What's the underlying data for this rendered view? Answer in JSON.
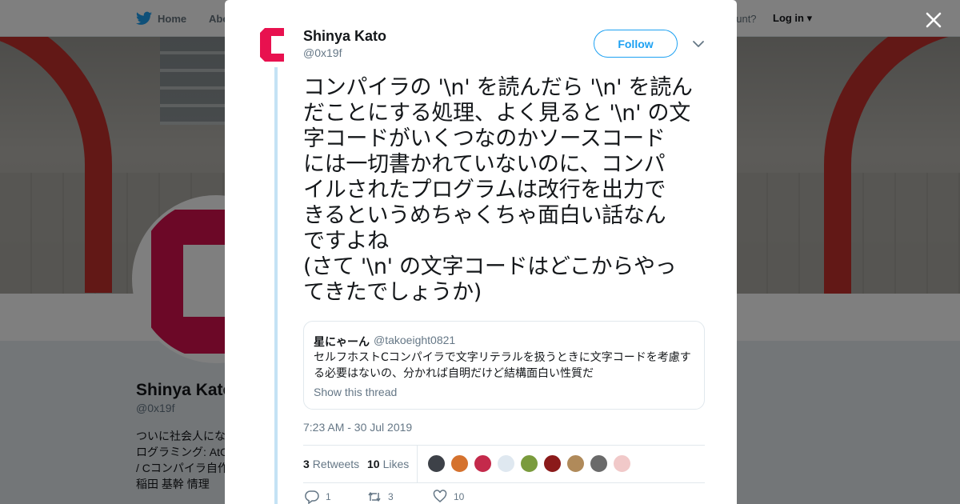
{
  "nav": {
    "home_label": "Home",
    "about_label": "Abo",
    "account_text": "ccount?",
    "login_label": "Log in"
  },
  "background_profile": {
    "name": "Shinya Kato",
    "handle": "@0x19f",
    "bio_lines": [
      "ついに社会人にな",
      "ログラミング: AtC",
      "/ Cコンパイラ自作",
      "稲田 基幹 情理"
    ]
  },
  "tweet": {
    "author_name": "Shinya Kato",
    "author_handle": "@0x19f",
    "follow_label": "Follow",
    "text": "コンパイラの '\\n' を読んだら '\\n' を読ん\nだことにする処理、よく見ると '\\n' の文\n字コードがいくつなのかソースコード\nには一切書かれていないのに、コンパ\nイルされたプログラムは改行を出力で\nきるというめちゃくちゃ面白い話なん\nですよね\n(さて '\\n' の文字コードはどこからやっ\nてきたでしょうか)",
    "quoted": {
      "name": "星にゃーん",
      "handle": "@takoeight0821",
      "text": "セルフホストCコンパイラで文字リテラルを扱うときに文字コードを考慮する必要はないの、分かれば自明だけど結構面白い性質だ",
      "show_thread": "Show this thread"
    },
    "timestamp": "7:23 AM - 30 Jul 2019",
    "stats": {
      "retweets_count": "3",
      "retweets_label": "Retweets",
      "likes_count": "10",
      "likes_label": "Likes"
    },
    "liker_colors": [
      "#3d4148",
      "#d5722e",
      "#c42a4b",
      "#dfe8f0",
      "#7a9b3d",
      "#8b1a1a",
      "#b08a5a",
      "#6a6a6a",
      "#f1c9c9"
    ],
    "actions": {
      "reply_count": "1",
      "retweet_count": "3",
      "like_count": "10"
    }
  },
  "colors": {
    "accent": "#1da1f2",
    "brand_pink": "#e8114f",
    "thread_line": "#c4e2f5"
  },
  "icons": [
    "twitter-bird-icon",
    "close-icon",
    "chevron-down-icon",
    "reply-icon",
    "retweet-icon",
    "heart-icon"
  ]
}
